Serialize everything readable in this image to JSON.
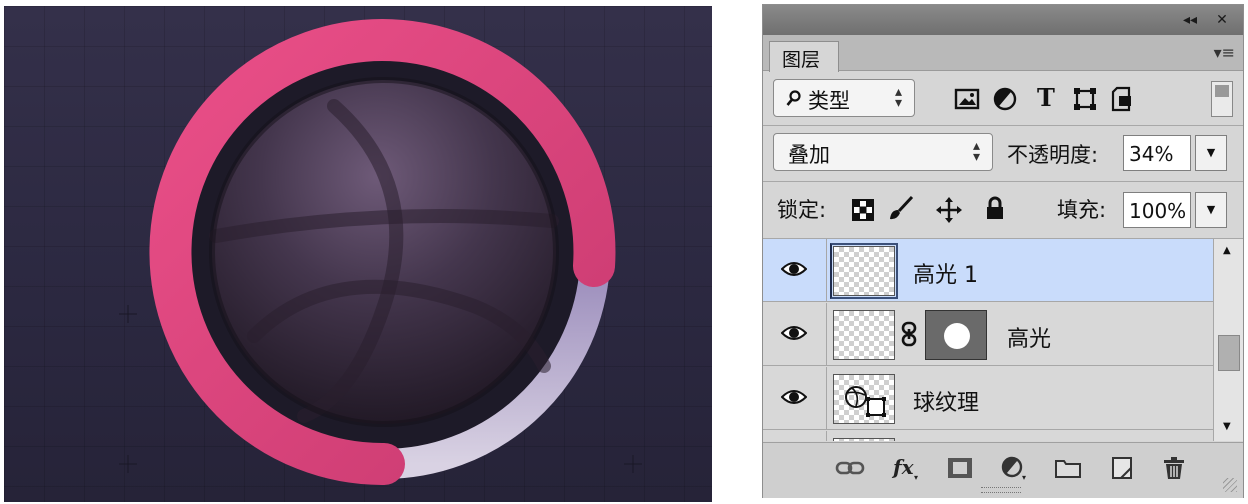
{
  "panel": {
    "title_buttons": {
      "collapse": "◂◂",
      "close": "✕"
    },
    "tab_label": "图层",
    "menu_icon": "panel-menu-icon",
    "filter": {
      "label": "类型",
      "icons": [
        "image-filter-icon",
        "adjustment-filter-icon",
        "type-filter-icon",
        "shape-filter-icon",
        "smart-object-filter-icon"
      ]
    },
    "blend_mode": "叠加",
    "opacity_label": "不透明度:",
    "opacity_value": "34%",
    "lock_label": "锁定:",
    "lock_icons": [
      "lock-transparent-icon",
      "lock-image-icon",
      "lock-position-icon",
      "lock-all-icon"
    ],
    "fill_label": "填充:",
    "fill_value": "100%",
    "layers": [
      {
        "name": "高光 1",
        "selected": true,
        "visible": true,
        "has_mask": false
      },
      {
        "name": "高光",
        "selected": false,
        "visible": true,
        "has_mask": true
      },
      {
        "name": "球纹理",
        "selected": false,
        "visible": true,
        "has_mask": false,
        "smart_object": true
      }
    ],
    "footer_icons": [
      "link-layers-icon",
      "fx-icon",
      "add-mask-icon",
      "adjustment-layer-icon",
      "group-folder-icon",
      "new-layer-icon",
      "delete-icon"
    ]
  },
  "colors": {
    "ring_pink": "#e0457f",
    "ring_lavender": "#a79ac2",
    "ball_dark": "#2d2232",
    "background": "#2e2b43",
    "selection": "#c9dcfb"
  }
}
